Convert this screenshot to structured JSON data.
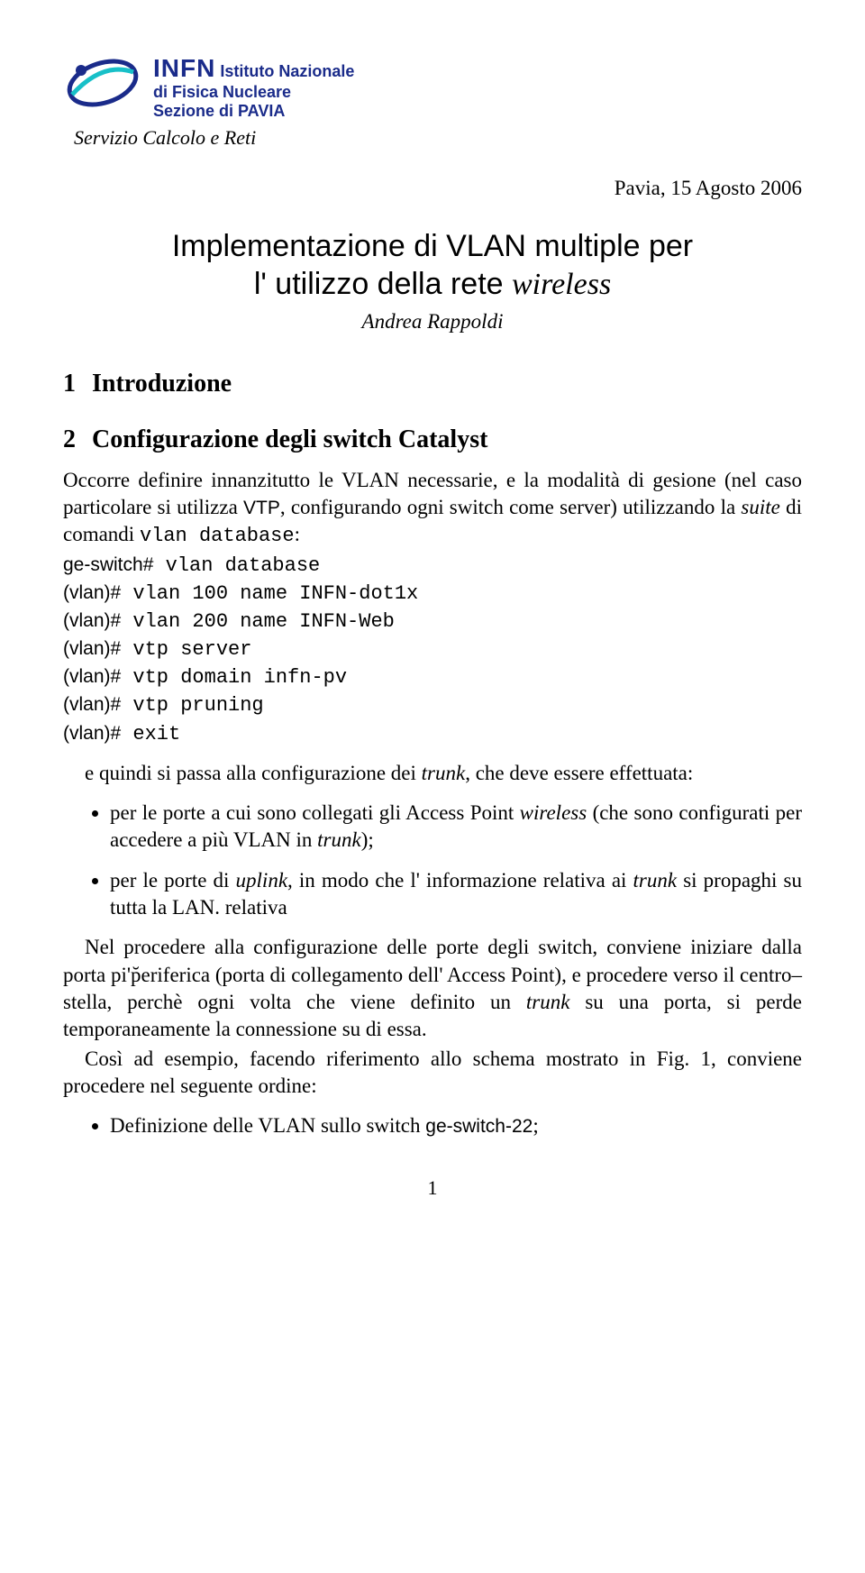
{
  "logo": {
    "acronym": "INFN",
    "line2": "Istituto Nazionale",
    "line3": "di Fisica Nucleare",
    "line4": "Sezione di PAVIA",
    "service": "Servizio Calcolo e Reti"
  },
  "date": "Pavia, 15 Agosto 2006",
  "title_line1": "Implementazione di VLAN multiple per",
  "title_line2a": "l' utilizzo della rete ",
  "title_line2b": "wireless",
  "author": "Andrea Rappoldi",
  "sections": {
    "s1": {
      "num": "1",
      "title": "Introduzione"
    },
    "s2": {
      "num": "2",
      "title": "Configurazione degli switch Catalyst"
    }
  },
  "para1a": "Occorre definire innanzitutto le VLAN necessarie, e la modalità di gesione (nel caso particolare si utilizza ",
  "para1b": "VTP",
  "para1c": ", configurando ogni switch come server) utilizzando la ",
  "para1d": "suite",
  "para1e": " di comandi ",
  "para1f": "vlan database",
  "para1g": ":",
  "commands": [
    {
      "prompt": "ge-switch#",
      "cmd": " vlan database"
    },
    {
      "prompt": "(vlan)#",
      "cmd": " vlan 100 name INFN-dot1x"
    },
    {
      "prompt": "(vlan)#",
      "cmd": " vlan 200 name INFN-Web"
    },
    {
      "prompt": "(vlan)#",
      "cmd": " vtp server"
    },
    {
      "prompt": "(vlan)#",
      "cmd": " vtp domain infn-pv"
    },
    {
      "prompt": "(vlan)#",
      "cmd": " vtp pruning"
    },
    {
      "prompt": "(vlan)#",
      "cmd": " exit"
    }
  ],
  "para2a": "e quindi si passa alla configurazione dei ",
  "para2b": "trunk",
  "para2c": ", che deve essere effettuata:",
  "bullets1": {
    "b1a": "per le porte a cui sono collegati gli Access Point ",
    "b1b": "wireless",
    "b1c": " (che sono configurati per accedere a più VLAN in ",
    "b1d": "trunk",
    "b1e": ");",
    "b2a": "per le porte di ",
    "b2b": "uplink",
    "b2c": ", in modo che l' informazione relativa ai ",
    "b2d": "trunk",
    "b2e": " si propaghi su tutta la LAN. relativa"
  },
  "para3a": "Nel procedere alla configurazione delle porte degli switch, conviene iniziare dalla porta pi'p̆eriferica (porta di collegamento dell' Access Point), e procedere verso il centro–stella, perchè ogni volta che viene definito un ",
  "para3b": "trunk",
  "para3c": " su una porta, si perde temporaneamente la connessione su di essa.",
  "para4a": "Così ad esempio, facendo riferimento allo schema mostrato in Fig. 1, conviene procedere nel seguente ordine:",
  "bullets2": {
    "b1a": "Definizione delle VLAN sullo switch ",
    "b1b": "ge-switch-22",
    "b1c": ";"
  },
  "pagenum": "1"
}
